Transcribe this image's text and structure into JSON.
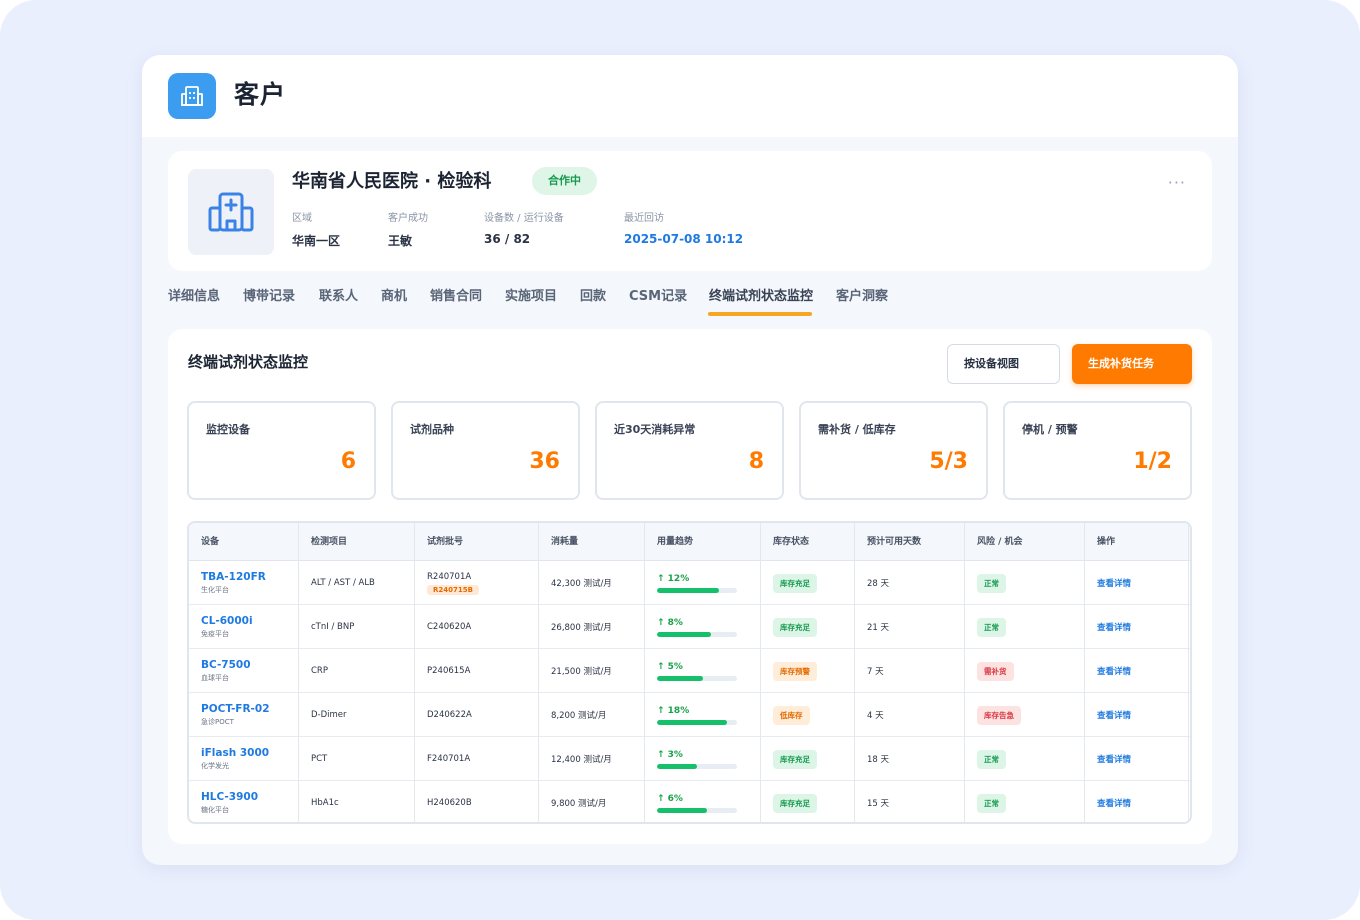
{
  "app": {
    "title": "客户"
  },
  "customer": {
    "name": "华南省人民医院 · 检验科",
    "status": "合作中",
    "more": "···",
    "meta": [
      {
        "label": "区域",
        "value": "华南一区"
      },
      {
        "label": "客户成功",
        "value": "王敏"
      },
      {
        "label": "设备数 / 运行设备",
        "value": "36 / 82"
      },
      {
        "label": "最近回访",
        "value": "2025-07-08 10:12"
      }
    ]
  },
  "tabs": [
    {
      "label": "详细信息"
    },
    {
      "label": "博带记录"
    },
    {
      "label": "联系人"
    },
    {
      "label": "商机"
    },
    {
      "label": "销售合同"
    },
    {
      "label": "实施项目"
    },
    {
      "label": "回款"
    },
    {
      "label": "CSM记录"
    },
    {
      "label": "终端试剂状态监控",
      "active": true
    },
    {
      "label": "客户洞察"
    }
  ],
  "panel": {
    "title": "终端试剂状态监控",
    "btn_view": "按设备视图",
    "btn_generate": "生成补货任务"
  },
  "stats": [
    {
      "label": "监控设备",
      "value": "6"
    },
    {
      "label": "试剂品种",
      "value": "36"
    },
    {
      "label": "近30天消耗异常",
      "value": "8"
    },
    {
      "label": "需补货 / 低库存",
      "value": "5/3"
    },
    {
      "label": "停机 / 预警",
      "value": "1/2"
    }
  ],
  "table": {
    "headers": [
      "设备",
      "检测项目",
      "试剂批号",
      "消耗量",
      "用量趋势",
      "库存状态",
      "预计可用天数",
      "风险 / 机会",
      "操作"
    ],
    "rows": [
      {
        "device": "TBA-120FR",
        "platform": "生化平台",
        "items": "ALT / AST / ALB",
        "lot": "R240701A",
        "lot_tag": "R240715B",
        "consumption": "42,300 测试/月",
        "trend": "↑ 12%",
        "trend_pct": 0.78,
        "stock": "库存充足",
        "stock_type": "green",
        "days": "28 天",
        "risk": "正常",
        "risk_type": "green",
        "action": "查看详情"
      },
      {
        "device": "CL-6000i",
        "platform": "免疫平台",
        "items": "cTnI / BNP",
        "lot": "C240620A",
        "lot_tag": "",
        "consumption": "26,800 测试/月",
        "trend": "↑ 8%",
        "trend_pct": 0.68,
        "stock": "库存充足",
        "stock_type": "green",
        "days": "21 天",
        "risk": "正常",
        "risk_type": "green",
        "action": "查看详情"
      },
      {
        "device": "BC-7500",
        "platform": "血球平台",
        "items": "CRP",
        "lot": "P240615A",
        "lot_tag": "",
        "consumption": "21,500 测试/月",
        "trend": "↑ 5%",
        "trend_pct": 0.58,
        "stock": "库存预警",
        "stock_type": "orange",
        "days": "7 天",
        "risk": "需补货",
        "risk_type": "red",
        "action": "查看详情"
      },
      {
        "device": "POCT-FR-02",
        "platform": "急诊POCT",
        "items": "D-Dimer",
        "lot": "D240622A",
        "lot_tag": "",
        "consumption": "8,200 测试/月",
        "trend": "↑ 18%",
        "trend_pct": 0.88,
        "stock": "低库存",
        "stock_type": "orange",
        "days": "4 天",
        "risk": "库存告急",
        "risk_type": "red",
        "action": "查看详情"
      },
      {
        "device": "iFlash 3000",
        "platform": "化学发光",
        "items": "PCT",
        "lot": "F240701A",
        "lot_tag": "",
        "consumption": "12,400 测试/月",
        "trend": "↑ 3%",
        "trend_pct": 0.5,
        "stock": "库存充足",
        "stock_type": "green",
        "days": "18 天",
        "risk": "正常",
        "risk_type": "green",
        "action": "查看详情"
      },
      {
        "device": "HLC-3900",
        "platform": "糖化平台",
        "items": "HbA1c",
        "lot": "H240620B",
        "lot_tag": "",
        "consumption": "9,800 测试/月",
        "trend": "↑ 6%",
        "trend_pct": 0.63,
        "stock": "库存充足",
        "stock_type": "green",
        "days": "15 天",
        "risk": "正常",
        "risk_type": "green",
        "action": "查看详情"
      }
    ]
  }
}
